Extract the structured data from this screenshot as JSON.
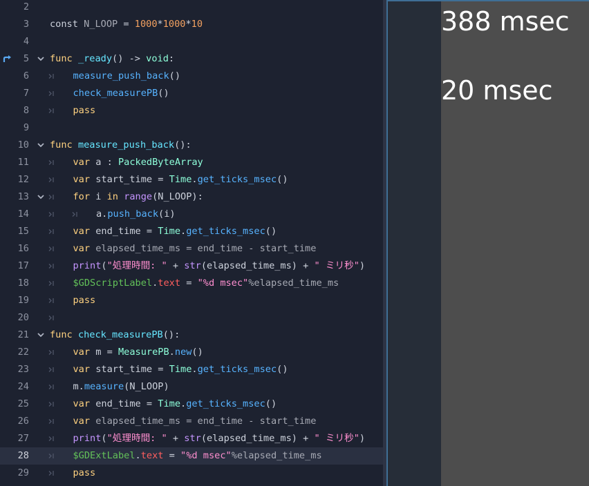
{
  "editor": {
    "current_line": 28,
    "lines": [
      {
        "n": "2",
        "fold": false,
        "tabs": 0,
        "tokens": []
      },
      {
        "n": "3",
        "fold": false,
        "tabs": 0,
        "tokens": [
          {
            "t": "const",
            "c": "plain"
          },
          {
            "t": " N_LOOP ",
            "c": "dim"
          },
          {
            "t": "=",
            "c": "plain"
          },
          {
            "t": " ",
            "c": "plain"
          },
          {
            "t": "1000",
            "c": "num2"
          },
          {
            "t": "*",
            "c": "plain"
          },
          {
            "t": "1000",
            "c": "num2"
          },
          {
            "t": "*",
            "c": "plain"
          },
          {
            "t": "10",
            "c": "num2"
          }
        ]
      },
      {
        "n": "4",
        "fold": false,
        "tabs": 0,
        "tokens": []
      },
      {
        "n": "5",
        "fold": true,
        "marker": true,
        "tabs": 0,
        "tokens": [
          {
            "t": "func",
            "c": "kw2"
          },
          {
            "t": " ",
            "c": "plain"
          },
          {
            "t": "_ready",
            "c": "fn"
          },
          {
            "t": "() -> ",
            "c": "plain"
          },
          {
            "t": "void",
            "c": "type"
          },
          {
            "t": ":",
            "c": "plain"
          }
        ]
      },
      {
        "n": "6",
        "fold": false,
        "tabs": 1,
        "tokens": [
          {
            "t": "measure_push_back",
            "c": "call"
          },
          {
            "t": "()",
            "c": "plain"
          }
        ]
      },
      {
        "n": "7",
        "fold": false,
        "tabs": 1,
        "tokens": [
          {
            "t": "check_measurePB",
            "c": "call"
          },
          {
            "t": "()",
            "c": "plain"
          }
        ]
      },
      {
        "n": "8",
        "fold": false,
        "tabs": 1,
        "tokens": [
          {
            "t": "pass",
            "c": "kw2"
          }
        ]
      },
      {
        "n": "9",
        "fold": false,
        "tabs": 0,
        "tokens": []
      },
      {
        "n": "10",
        "fold": true,
        "tabs": 0,
        "tokens": [
          {
            "t": "func",
            "c": "kw2"
          },
          {
            "t": " ",
            "c": "plain"
          },
          {
            "t": "measure_push_back",
            "c": "fn"
          },
          {
            "t": "():",
            "c": "plain"
          }
        ]
      },
      {
        "n": "11",
        "fold": false,
        "tabs": 1,
        "tokens": [
          {
            "t": "var",
            "c": "kw2"
          },
          {
            "t": " a : ",
            "c": "plain"
          },
          {
            "t": "PackedByteArray",
            "c": "type"
          }
        ]
      },
      {
        "n": "12",
        "fold": false,
        "tabs": 1,
        "tokens": [
          {
            "t": "var",
            "c": "kw2"
          },
          {
            "t": " start_time = ",
            "c": "plain"
          },
          {
            "t": "Time",
            "c": "type"
          },
          {
            "t": ".",
            "c": "plain"
          },
          {
            "t": "get_ticks_msec",
            "c": "call"
          },
          {
            "t": "()",
            "c": "plain"
          }
        ]
      },
      {
        "n": "13",
        "fold": true,
        "tabs": 1,
        "tokens": [
          {
            "t": "for",
            "c": "kw2"
          },
          {
            "t": " i ",
            "c": "plain"
          },
          {
            "t": "in",
            "c": "kw2"
          },
          {
            "t": " ",
            "c": "plain"
          },
          {
            "t": "range",
            "c": "builtin"
          },
          {
            "t": "(N_LOOP):",
            "c": "plain"
          }
        ]
      },
      {
        "n": "14",
        "fold": false,
        "tabs": 2,
        "tokens": [
          {
            "t": "a.",
            "c": "plain"
          },
          {
            "t": "push_back",
            "c": "call"
          },
          {
            "t": "(i)",
            "c": "plain"
          }
        ]
      },
      {
        "n": "15",
        "fold": false,
        "tabs": 1,
        "tokens": [
          {
            "t": "var",
            "c": "kw2"
          },
          {
            "t": " end_time = ",
            "c": "plain"
          },
          {
            "t": "Time",
            "c": "type"
          },
          {
            "t": ".",
            "c": "plain"
          },
          {
            "t": "get_ticks_msec",
            "c": "call"
          },
          {
            "t": "()",
            "c": "plain"
          }
        ]
      },
      {
        "n": "16",
        "fold": false,
        "tabs": 1,
        "tokens": [
          {
            "t": "var",
            "c": "kw2"
          },
          {
            "t": " elapsed_time_ms = end_time - start_time",
            "c": "dim"
          }
        ]
      },
      {
        "n": "17",
        "fold": false,
        "tabs": 1,
        "tokens": [
          {
            "t": "print",
            "c": "builtin"
          },
          {
            "t": "(",
            "c": "plain"
          },
          {
            "t": "\"処理時間: \"",
            "c": "strp"
          },
          {
            "t": " + ",
            "c": "plain"
          },
          {
            "t": "str",
            "c": "builtin"
          },
          {
            "t": "(elapsed_time_ms) + ",
            "c": "plain"
          },
          {
            "t": "\" ミリ秒\"",
            "c": "strp"
          },
          {
            "t": ")",
            "c": "plain"
          }
        ]
      },
      {
        "n": "18",
        "fold": false,
        "tabs": 1,
        "tokens": [
          {
            "t": "$GDScriptLabel",
            "c": "node"
          },
          {
            "t": ".",
            "c": "plain"
          },
          {
            "t": "text",
            "c": "prop"
          },
          {
            "t": " = ",
            "c": "plain"
          },
          {
            "t": "\"%d msec\"",
            "c": "strp"
          },
          {
            "t": "%elapsed_time_ms",
            "c": "dim"
          }
        ]
      },
      {
        "n": "19",
        "fold": false,
        "tabs": 1,
        "tokens": [
          {
            "t": "pass",
            "c": "kw2"
          }
        ]
      },
      {
        "n": "20",
        "fold": false,
        "tabs": 1,
        "tokens": []
      },
      {
        "n": "21",
        "fold": true,
        "tabs": 0,
        "tokens": [
          {
            "t": "func",
            "c": "kw2"
          },
          {
            "t": " ",
            "c": "plain"
          },
          {
            "t": "check_measurePB",
            "c": "fn"
          },
          {
            "t": "():",
            "c": "plain"
          }
        ]
      },
      {
        "n": "22",
        "fold": false,
        "tabs": 1,
        "tokens": [
          {
            "t": "var",
            "c": "kw2"
          },
          {
            "t": " m = ",
            "c": "plain"
          },
          {
            "t": "MeasurePB",
            "c": "type"
          },
          {
            "t": ".",
            "c": "plain"
          },
          {
            "t": "new",
            "c": "call"
          },
          {
            "t": "()",
            "c": "plain"
          }
        ]
      },
      {
        "n": "23",
        "fold": false,
        "tabs": 1,
        "tokens": [
          {
            "t": "var",
            "c": "kw2"
          },
          {
            "t": " start_time = ",
            "c": "plain"
          },
          {
            "t": "Time",
            "c": "type"
          },
          {
            "t": ".",
            "c": "plain"
          },
          {
            "t": "get_ticks_msec",
            "c": "call"
          },
          {
            "t": "()",
            "c": "plain"
          }
        ]
      },
      {
        "n": "24",
        "fold": false,
        "tabs": 1,
        "tokens": [
          {
            "t": "m.",
            "c": "plain"
          },
          {
            "t": "measure",
            "c": "call"
          },
          {
            "t": "(N_LOOP)",
            "c": "plain"
          }
        ]
      },
      {
        "n": "25",
        "fold": false,
        "tabs": 1,
        "tokens": [
          {
            "t": "var",
            "c": "kw2"
          },
          {
            "t": " end_time = ",
            "c": "plain"
          },
          {
            "t": "Time",
            "c": "type"
          },
          {
            "t": ".",
            "c": "plain"
          },
          {
            "t": "get_ticks_msec",
            "c": "call"
          },
          {
            "t": "()",
            "c": "plain"
          }
        ]
      },
      {
        "n": "26",
        "fold": false,
        "tabs": 1,
        "tokens": [
          {
            "t": "var",
            "c": "kw2"
          },
          {
            "t": " elapsed_time_ms = end_time - start_time",
            "c": "dim"
          }
        ]
      },
      {
        "n": "27",
        "fold": false,
        "tabs": 1,
        "tokens": [
          {
            "t": "print",
            "c": "builtin"
          },
          {
            "t": "(",
            "c": "plain"
          },
          {
            "t": "\"処理時間: \"",
            "c": "strp"
          },
          {
            "t": " + ",
            "c": "plain"
          },
          {
            "t": "str",
            "c": "builtin"
          },
          {
            "t": "(elapsed_time_ms) + ",
            "c": "plain"
          },
          {
            "t": "\" ミリ秒\"",
            "c": "strp"
          },
          {
            "t": ")",
            "c": "plain"
          }
        ]
      },
      {
        "n": "28",
        "fold": false,
        "tabs": 1,
        "tokens": [
          {
            "t": "$GDExtLabel",
            "c": "node"
          },
          {
            "t": ".",
            "c": "plain"
          },
          {
            "t": "text",
            "c": "prop"
          },
          {
            "t": " = ",
            "c": "plain"
          },
          {
            "t": "\"%d msec\"",
            "c": "strp"
          },
          {
            "t": "%elapsed_time_ms",
            "c": "dim"
          }
        ]
      },
      {
        "n": "29",
        "fold": false,
        "tabs": 1,
        "tokens": [
          {
            "t": "pass",
            "c": "kw2"
          }
        ]
      }
    ]
  },
  "preview": {
    "gdscript_label": "388 msec",
    "gdext_label": "20 msec"
  },
  "icons": {
    "fold": "chevron-down-icon",
    "indent": "tab-indent-icon",
    "marker": "breakpoint-arrow-icon"
  }
}
